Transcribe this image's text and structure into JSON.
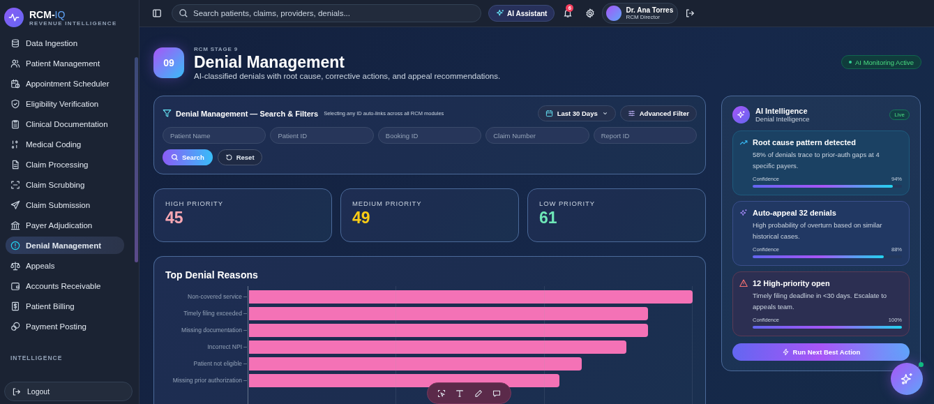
{
  "brand": {
    "name": "RCM-",
    "name_accent": "IQ",
    "tagline": "REVENUE INTELLIGENCE"
  },
  "sidebar": {
    "items": [
      {
        "label": "Data Ingestion",
        "selected": false
      },
      {
        "label": "Patient Management",
        "selected": false
      },
      {
        "label": "Appointment Scheduler",
        "selected": false
      },
      {
        "label": "Eligibility Verification",
        "selected": false
      },
      {
        "label": "Clinical Documentation",
        "selected": false
      },
      {
        "label": "Medical Coding",
        "selected": false
      },
      {
        "label": "Claim Processing",
        "selected": false
      },
      {
        "label": "Claim Scrubbing",
        "selected": false
      },
      {
        "label": "Claim Submission",
        "selected": false
      },
      {
        "label": "Payer Adjudication",
        "selected": false
      },
      {
        "label": "Denial Management",
        "selected": true
      },
      {
        "label": "Appeals",
        "selected": false
      },
      {
        "label": "Accounts Receivable",
        "selected": false
      },
      {
        "label": "Patient Billing",
        "selected": false
      },
      {
        "label": "Payment Posting",
        "selected": false
      }
    ],
    "section": "INTELLIGENCE",
    "logout": "Logout"
  },
  "topbar": {
    "search_placeholder": "Search patients, claims, providers, denials...",
    "ai_button": "AI Assistant",
    "notifications": "6",
    "user": {
      "name": "Dr. Ana Torres",
      "role": "RCM Director"
    }
  },
  "header": {
    "badge": "09",
    "eyebrow": "RCM STAGE 9",
    "title": "Denial Management",
    "subtitle": "AI-classified denials with root cause, corrective actions, and appeal recommendations.",
    "status": "AI Monitoring Active"
  },
  "filters": {
    "title": "Denial Management — Search & Filters",
    "hint": "Selecting any ID auto-links across all RCM modules",
    "date_range": "Last 30 Days",
    "advanced": "Advanced Filter",
    "fields": [
      {
        "placeholder": "Patient Name"
      },
      {
        "placeholder": "Patient ID"
      },
      {
        "placeholder": "Booking ID"
      },
      {
        "placeholder": "Claim Number"
      },
      {
        "placeholder": "Report ID"
      }
    ],
    "search": "Search",
    "reset": "Reset"
  },
  "stats": [
    {
      "label": "HIGH PRIORITY",
      "value": "45",
      "color": "#f9a8b4"
    },
    {
      "label": "MEDIUM PRIORITY",
      "value": "49",
      "color": "#facc15"
    },
    {
      "label": "LOW PRIORITY",
      "value": "61",
      "color": "#6ee7b7"
    }
  ],
  "reasons": {
    "title": "Top Denial Reasons",
    "bars": [
      {
        "label": "Non-covered service"
      },
      {
        "label": "Timely filing exceeded"
      },
      {
        "label": "Missing documentation"
      },
      {
        "label": "Incorrect NPI"
      },
      {
        "label": "Patient not eligible"
      },
      {
        "label": "Missing prior authorization"
      }
    ]
  },
  "ai_panel": {
    "title": "AI Intelligence",
    "subtitle": "Denial Intelligence",
    "badge": "Live",
    "insights": [
      {
        "kind": "trend",
        "title": "Root cause pattern detected",
        "text": "58% of denials trace to prior-auth gaps at 4 specific payers.",
        "confidence_label": "Confidence",
        "reading": "94%",
        "level": 0.94
      },
      {
        "kind": "sparkle",
        "title": "Auto-appeal 32 denials",
        "text": "High probability of overturn based on similar historical cases.",
        "confidence_label": "Confidence",
        "reading": "88%",
        "level": 0.88
      },
      {
        "kind": "warning",
        "title": "12 High-priority open",
        "text": "Timely filing deadline in <30 days. Escalate to appeals team.",
        "confidence_label": "Confidence",
        "reading": "100%",
        "level": 1.0
      }
    ],
    "action": "Run Next Best Action"
  }
}
